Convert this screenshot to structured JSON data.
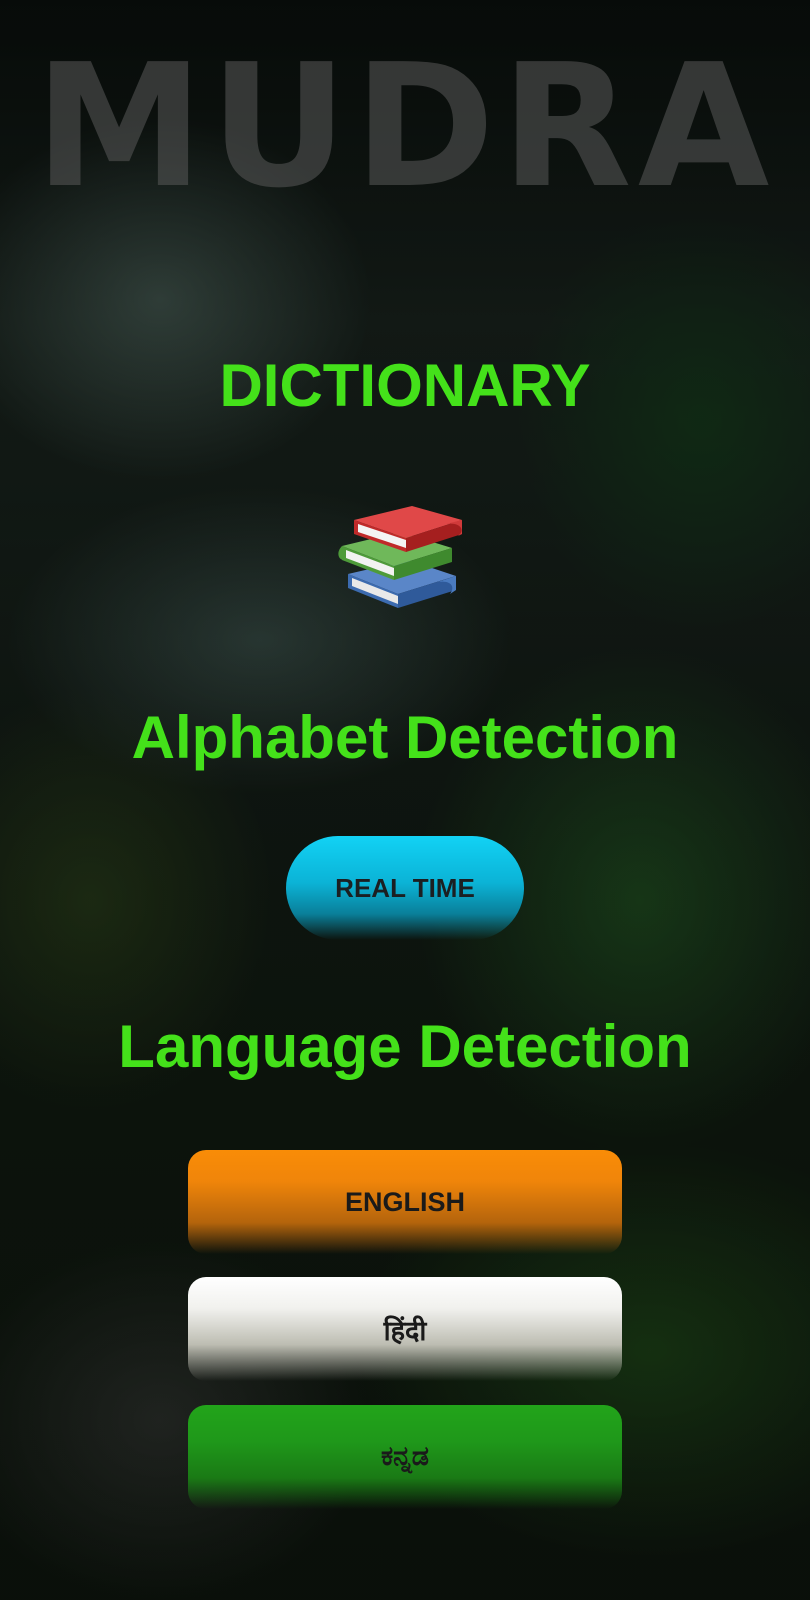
{
  "app": {
    "brand": "MUDRA"
  },
  "dictionary": {
    "title": "DICTIONARY",
    "icon": "books-icon"
  },
  "alphabet": {
    "title": "Alphabet Detection",
    "realtime_label": "REAL TIME",
    "realtime_color": "#12d2f5"
  },
  "language": {
    "title": "Language Detection",
    "buttons": [
      {
        "label": "ENGLISH",
        "color": "#f98c07"
      },
      {
        "label": "हिंदी",
        "color": "#ffffff"
      },
      {
        "label": "ಕನ್ನಡ",
        "color": "#22a41a"
      }
    ]
  },
  "theme": {
    "heading_color": "#44e11a",
    "brand_color": "#5a5a5a"
  }
}
